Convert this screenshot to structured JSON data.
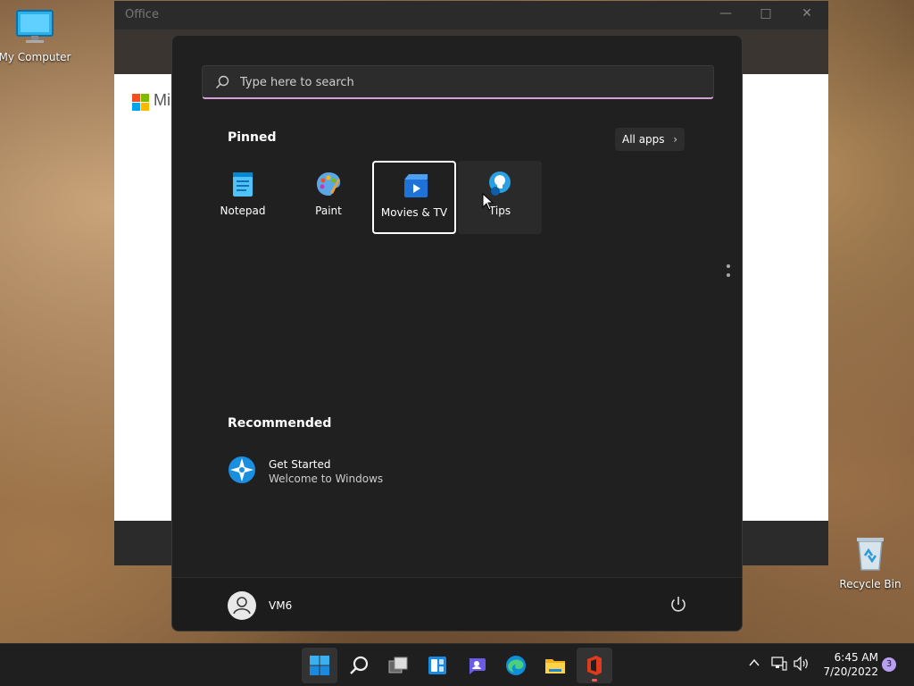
{
  "desktop": {
    "icons": [
      {
        "label": "My Computer",
        "icon": "monitor-icon"
      },
      {
        "label": "Recycle Bin",
        "icon": "recycle-bin-icon"
      }
    ]
  },
  "office_window": {
    "title": "Office",
    "brand_text": "Mi"
  },
  "start_menu": {
    "search": {
      "placeholder": "Type here to search"
    },
    "pinned_title": "Pinned",
    "all_apps_label": "All apps",
    "pinned": [
      {
        "label": "Notepad",
        "icon": "notepad-icon"
      },
      {
        "label": "Paint",
        "icon": "paint-icon"
      },
      {
        "label": "Movies & TV",
        "icon": "movies-tv-icon",
        "state": "focused"
      },
      {
        "label": "Tips",
        "icon": "tips-icon",
        "state": "hover"
      }
    ],
    "recommended_title": "Recommended",
    "recommended": [
      {
        "title": "Get Started",
        "subtitle": "Welcome to Windows",
        "icon": "get-started-icon"
      }
    ],
    "user": {
      "name": "VM6"
    }
  },
  "taskbar": {
    "apps": [
      "start-icon",
      "search-icon",
      "task-view-icon",
      "widgets-icon",
      "teams-chat-icon",
      "edge-icon",
      "file-explorer-icon",
      "office-icon"
    ],
    "clock": {
      "time": "6:45 AM",
      "date": "7/20/2022"
    },
    "notification_count": "3"
  },
  "colors": {
    "start_bg": "#202020",
    "search_underline": "#d8a0d8",
    "accent_blue": "#0078d4"
  }
}
